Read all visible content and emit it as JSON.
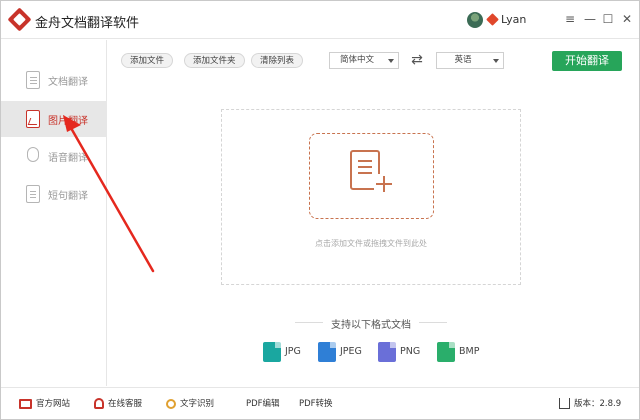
{
  "app": {
    "title": "金舟文档翻译软件"
  },
  "user": {
    "name": "Lyan"
  },
  "window_controls": {
    "menu": "≡",
    "minimize": "—",
    "maximize": "☐",
    "close": "✕"
  },
  "sidebar": {
    "items": [
      {
        "label": "文档翻译",
        "icon": "document-icon",
        "active": false
      },
      {
        "label": "图片翻译",
        "icon": "image-icon",
        "active": true
      },
      {
        "label": "语音翻译",
        "icon": "microphone-icon",
        "active": false
      },
      {
        "label": "短句翻译",
        "icon": "sentence-icon",
        "active": false
      }
    ]
  },
  "toolbar": {
    "add_file": "添加文件",
    "add_folder": "添加文件夹",
    "clear_list": "清除列表",
    "source_lang": "简体中文",
    "target_lang": "英语",
    "swap_symbol": "⇄",
    "start": "开始翻译"
  },
  "dropzone": {
    "hint": "点击添加文件或拖拽文件到此处"
  },
  "formats": {
    "title": "支持以下格式文档",
    "items": [
      {
        "name": "JPG",
        "color": "#1aa7a0"
      },
      {
        "name": "JPEG",
        "color": "#2f7fd6"
      },
      {
        "name": "PNG",
        "color": "#6a6fd8"
      },
      {
        "name": "BMP",
        "color": "#2aae6b"
      }
    ]
  },
  "footer": {
    "website": "官方网站",
    "service": "在线客服",
    "ocr": "文字识别",
    "pdf_edit": "PDF编辑",
    "pdf_convert": "PDF转换",
    "version": "版本：2.8.9"
  },
  "colors": {
    "brand": "#c8332a",
    "start": "#27a55a",
    "accent": "#c8734f"
  }
}
